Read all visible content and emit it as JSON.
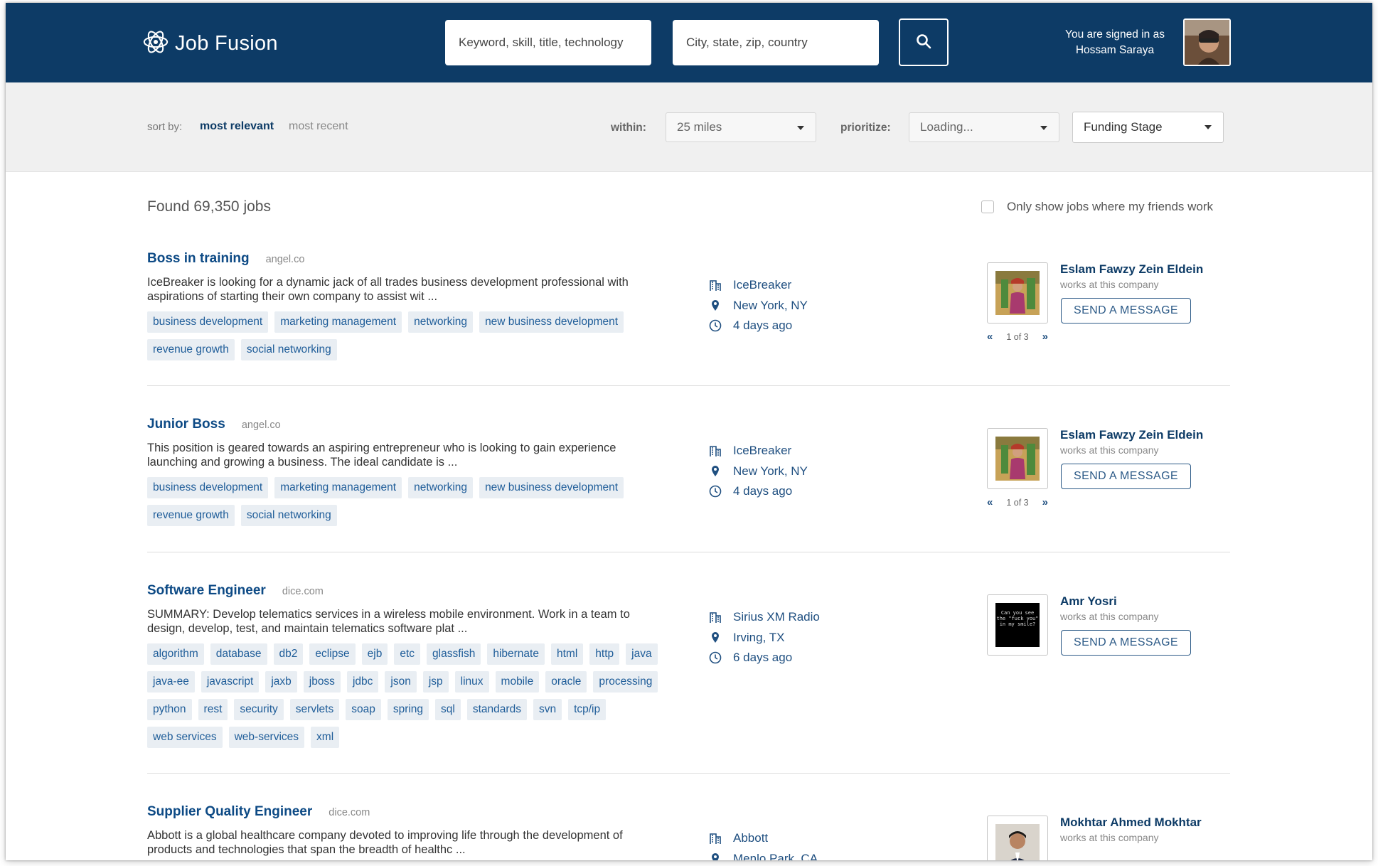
{
  "header": {
    "logo_text": "Job Fusion",
    "keyword_placeholder": "Keyword, skill, title, technology",
    "location_placeholder": "City, state, zip, country",
    "signed_in_line1": "You are signed in as",
    "signed_in_name": "Hossam Saraya"
  },
  "filters": {
    "sort_label": "sort by:",
    "sort_active": "most relevant",
    "sort_inactive": "most recent",
    "within_label": "within:",
    "within_value": "25 miles",
    "prioritize_label": "prioritize:",
    "prioritize_value": "Loading...",
    "funding_value": "Funding Stage"
  },
  "results": {
    "found_text": "Found 69,350 jobs",
    "friends_filter_label": "Only show jobs where my friends work",
    "friends_filter_checked": false
  },
  "jobs": [
    {
      "title": "Boss in training",
      "source": "angel.co",
      "description": "IceBreaker is looking for a dynamic jack of all trades business development professional with aspirations of starting their own company to assist wit ...",
      "tags": [
        "business development",
        "marketing management",
        "networking",
        "new business development",
        "revenue growth",
        "social networking"
      ],
      "company": "IceBreaker",
      "location": "New York, NY",
      "posted": "4 days ago",
      "contact": {
        "name": "Eslam Fawzy Zein Eldein",
        "subtitle": "works at this company",
        "button": "SEND A MESSAGE",
        "pager": "1 of 3"
      }
    },
    {
      "title": "Junior Boss",
      "source": "angel.co",
      "description": "This position is geared towards an aspiring entrepreneur who is looking to gain experience launching and growing a business. The ideal candidate is ...",
      "tags": [
        "business development",
        "marketing management",
        "networking",
        "new business development",
        "revenue growth",
        "social networking"
      ],
      "company": "IceBreaker",
      "location": "New York, NY",
      "posted": "4 days ago",
      "contact": {
        "name": "Eslam Fawzy Zein Eldein",
        "subtitle": "works at this company",
        "button": "SEND A MESSAGE",
        "pager": "1 of 3"
      }
    },
    {
      "title": "Software Engineer",
      "source": "dice.com",
      "description": "SUMMARY: Develop telematics services in a wireless mobile environment. Work in a team to design, develop, test, and maintain telematics software plat ...",
      "tags": [
        "algorithm",
        "database",
        "db2",
        "eclipse",
        "ejb",
        "etc",
        "glassfish",
        "hibernate",
        "html",
        "http",
        "java",
        "java-ee",
        "javascript",
        "jaxb",
        "jboss",
        "jdbc",
        "json",
        "jsp",
        "linux",
        "mobile",
        "oracle",
        "processing",
        "python",
        "rest",
        "security",
        "servlets",
        "soap",
        "spring",
        "sql",
        "standards",
        "svn",
        "tcp/ip",
        "web services",
        "web-services",
        "xml"
      ],
      "company": "Sirius XM Radio",
      "location": "Irving, TX",
      "posted": "6 days ago",
      "contact": {
        "name": "Amr Yosri",
        "subtitle": "works at this company",
        "button": "SEND A MESSAGE",
        "photo_text": "Can you see the \"fuck you\" in my smile?"
      }
    },
    {
      "title": "Supplier Quality Engineer",
      "source": "dice.com",
      "description": "Abbott is a global healthcare company devoted to improving life through the development of products and technologies that span the breadth of healthc ...",
      "tags": [],
      "company": "Abbott",
      "location": "Menlo Park, CA",
      "posted": "",
      "contact": {
        "name": "Mokhtar Ahmed Mokhtar",
        "subtitle": "works at this company"
      }
    }
  ],
  "colors": {
    "header_bg": "#0d3b66",
    "title_link": "#0d4a85",
    "tag_bg": "#e9eef3",
    "tag_text": "#1f5d99"
  },
  "icons": [
    "logo-atom-icon",
    "search-icon",
    "building-icon",
    "location-pin-icon",
    "clock-icon"
  ]
}
